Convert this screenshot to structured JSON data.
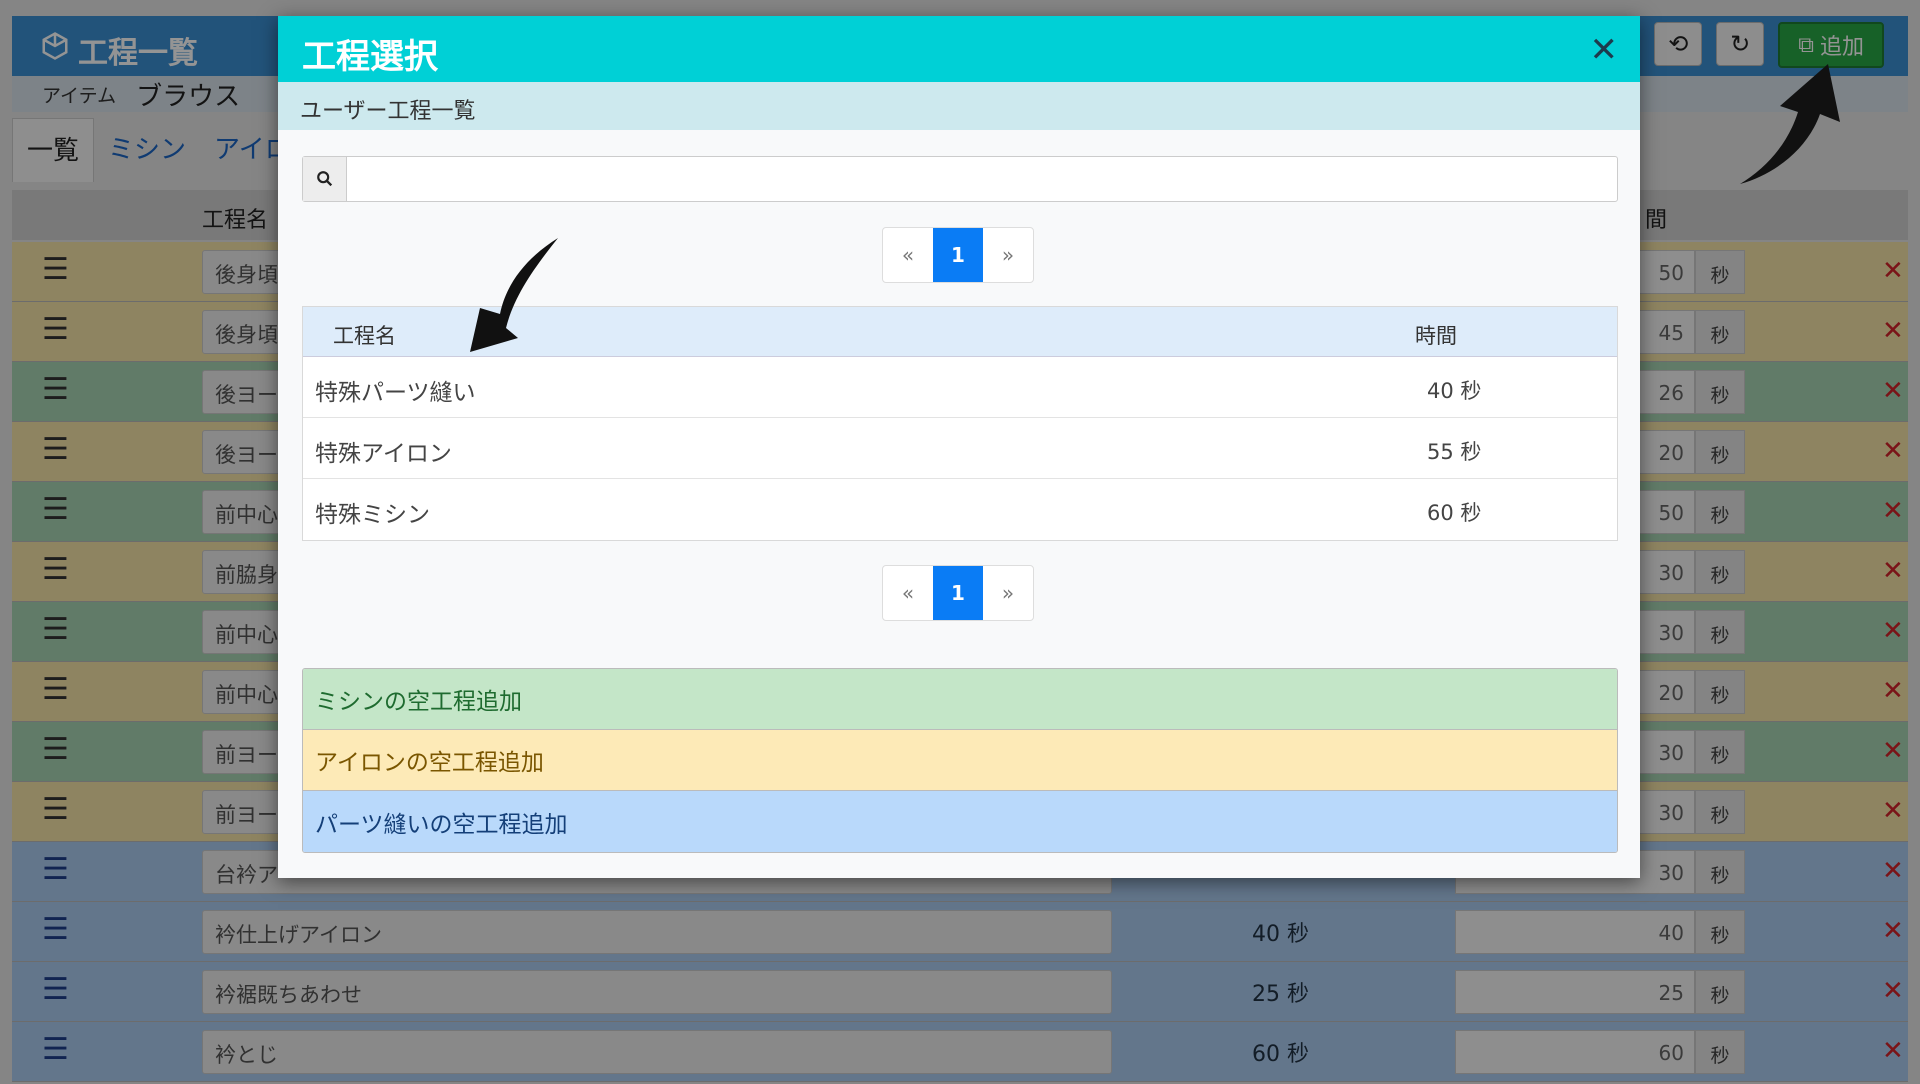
{
  "background": {
    "title": "工程一覧",
    "item_label": "アイテム",
    "item_value": "ブラウス",
    "add_button": "追加",
    "tabs": [
      "一覧",
      "ミシン",
      "アイロ"
    ],
    "col_name": "工程名",
    "col_time": "間",
    "unit": "秒",
    "rows": [
      {
        "name": "後身頃",
        "sec": "",
        "val": "50",
        "color": "yellow"
      },
      {
        "name": "後身頃",
        "sec": "",
        "val": "45",
        "color": "yellow"
      },
      {
        "name": "後ヨー",
        "sec": "",
        "val": "26",
        "color": "green"
      },
      {
        "name": "後ヨー",
        "sec": "",
        "val": "20",
        "color": "yellow"
      },
      {
        "name": "前中心",
        "sec": "",
        "val": "50",
        "color": "green"
      },
      {
        "name": "前脇身",
        "sec": "",
        "val": "30",
        "color": "yellow"
      },
      {
        "name": "前中心",
        "sec": "",
        "val": "30",
        "color": "green"
      },
      {
        "name": "前中心",
        "sec": "",
        "val": "20",
        "color": "yellow"
      },
      {
        "name": "前ヨー",
        "sec": "",
        "val": "30",
        "color": "green"
      },
      {
        "name": "前ヨー",
        "sec": "",
        "val": "30",
        "color": "yellow"
      },
      {
        "name": "台衿ア",
        "sec": "",
        "val": "30",
        "color": "blue"
      },
      {
        "name": "衿仕上げアイロン",
        "sec": "40 秒",
        "val": "40",
        "color": "blue"
      },
      {
        "name": "衿裾既ちあわせ",
        "sec": "25 秒",
        "val": "25",
        "color": "blue"
      },
      {
        "name": "衿とじ",
        "sec": "60 秒",
        "val": "60",
        "color": "blue"
      }
    ]
  },
  "modal": {
    "title": "工程選択",
    "subtitle": "ユーザー工程一覧",
    "search_value": "",
    "pager": {
      "prev": "«",
      "current": "1",
      "next": "»"
    },
    "table": {
      "col_name": "工程名",
      "col_time": "時間",
      "rows": [
        {
          "name": "特殊パーツ縫い",
          "time": "40 秒"
        },
        {
          "name": "特殊アイロン",
          "time": "55 秒"
        },
        {
          "name": "特殊ミシン",
          "time": "60 秒"
        }
      ]
    },
    "add_options": [
      {
        "label": "ミシンの空工程追加",
        "kind": "green"
      },
      {
        "label": "アイロンの空工程追加",
        "kind": "yellow"
      },
      {
        "label": "パーツ縫いの空工程追加",
        "kind": "blue"
      }
    ]
  }
}
